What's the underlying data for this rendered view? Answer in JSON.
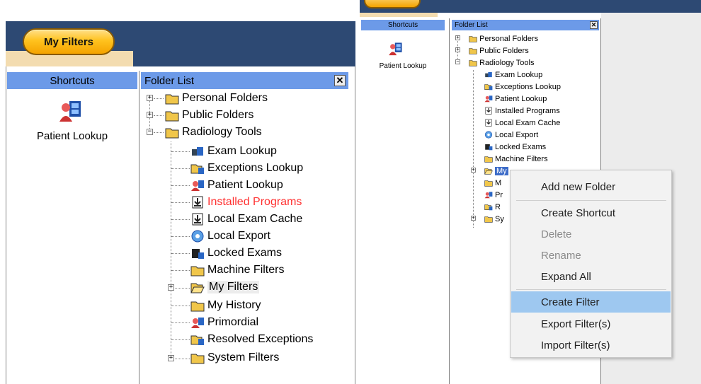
{
  "left_panel": {
    "tab_title": "My Filters",
    "shortcuts_header": "Shortcuts",
    "shortcut_label": "Patient Lookup",
    "folder_list_header": "Folder List",
    "close_glyph": "✕",
    "tree": {
      "personal_folders": "Personal Folders",
      "public_folders": "Public Folders",
      "radiology_tools": "Radiology Tools",
      "exam_lookup": "Exam Lookup",
      "exceptions_lookup": "Exceptions Lookup",
      "patient_lookup": "Patient Lookup",
      "installed_programs": "Installed Programs",
      "local_exam_cache": "Local Exam Cache",
      "local_export": "Local Export",
      "locked_exams": "Locked Exams",
      "machine_filters": "Machine Filters",
      "my_filters": "My Filters",
      "my_history": "My History",
      "primordial": "Primordial",
      "resolved_exceptions": "Resolved Exceptions",
      "system_filters": "System Filters"
    }
  },
  "right_panel": {
    "shortcuts_header": "Shortcuts",
    "shortcut_label": "Patient Lookup",
    "folder_list_header": "Folder List",
    "close_glyph": "✕",
    "tree": {
      "personal_folders": "Personal Folders",
      "public_folders": "Public Folders",
      "radiology_tools": "Radiology Tools",
      "exam_lookup": "Exam Lookup",
      "exceptions_lookup": "Exceptions Lookup",
      "patient_lookup": "Patient Lookup",
      "installed_programs": "Installed Programs",
      "local_exam_cache": "Local Exam Cache",
      "local_export": "Local Export",
      "locked_exams": "Locked Exams",
      "machine_filters": "Machine Filters",
      "my_filters_partial": "My",
      "my_history_partial": "M",
      "primordial_partial": "Pr",
      "resolved_partial": "R",
      "system_partial": "Sy"
    },
    "context_menu": {
      "add_new_folder": "Add new Folder",
      "create_shortcut": "Create Shortcut",
      "delete": "Delete",
      "rename": "Rename",
      "expand_all": "Expand All",
      "create_filter": "Create Filter",
      "export_filters": "Export Filter(s)",
      "import_filters": "Import Filter(s)"
    }
  },
  "colors": {
    "header_blue": "#2d4973",
    "pane_header": "#6c9ae8",
    "tab_gold": "#ffc21e",
    "installed_red": "#ff3030",
    "menu_highlight": "#9ec8f0"
  }
}
